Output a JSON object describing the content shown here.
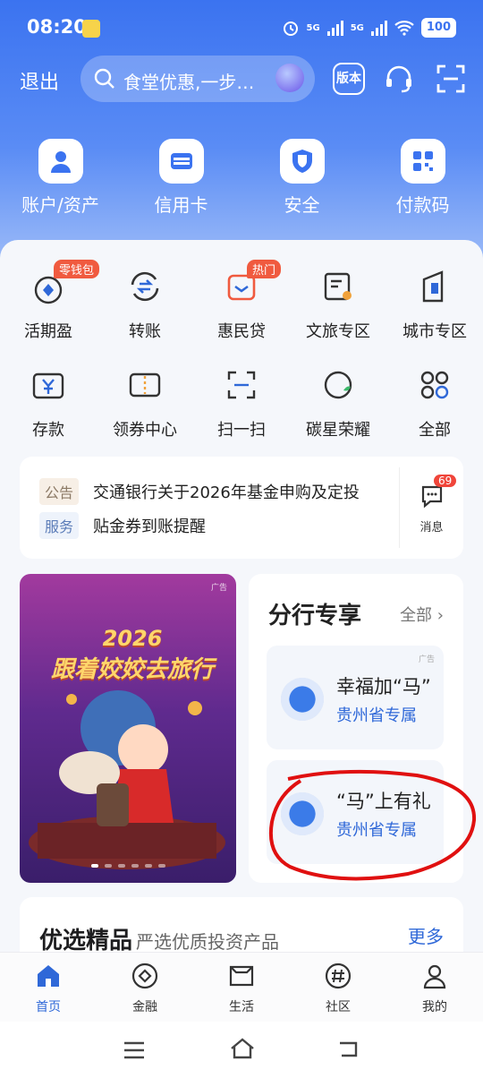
{
  "status_bar": {
    "time": "08:20",
    "network_1": "5G",
    "network_2": "5G",
    "battery": "100"
  },
  "top_bar": {
    "logout": "退出",
    "search_placeholder": "食堂优惠,一步…",
    "version_label": "版本"
  },
  "quick_actions": [
    {
      "label": "账户/资产",
      "icon": "person-icon"
    },
    {
      "label": "信用卡",
      "icon": "card-icon"
    },
    {
      "label": "安全",
      "icon": "shield-icon"
    },
    {
      "label": "付款码",
      "icon": "qr-code-icon"
    }
  ],
  "services_row1": [
    {
      "label": "活期盈",
      "badge": "零钱包",
      "icon": "piggy-icon"
    },
    {
      "label": "转账",
      "badge": "",
      "icon": "transfer-icon"
    },
    {
      "label": "惠民贷",
      "badge": "热门",
      "icon": "loan-icon"
    },
    {
      "label": "文旅专区",
      "badge": "",
      "icon": "scroll-icon"
    },
    {
      "label": "城市专区",
      "badge": "",
      "icon": "building-icon"
    }
  ],
  "services_row2": [
    {
      "label": "存款",
      "icon": "deposit-icon"
    },
    {
      "label": "领券中心",
      "icon": "coupon-icon"
    },
    {
      "label": "扫一扫",
      "icon": "scan-icon"
    },
    {
      "label": "碳星荣耀",
      "icon": "globe-icon"
    },
    {
      "label": "全部",
      "icon": "grid-icon"
    }
  ],
  "notices": [
    {
      "tag": "公告",
      "text": "交通银行关于2026年基金申购及定投"
    },
    {
      "tag": "服务",
      "text": "贴金券到账提醒"
    }
  ],
  "messages": {
    "label": "消息",
    "count": "69"
  },
  "banner": {
    "ad": "广告",
    "year": "2026",
    "title": "跟着姣姣去旅行"
  },
  "branch": {
    "title": "分行专享",
    "all_label": "全部",
    "cards": [
      {
        "title": "幸福加“马”",
        "subtitle": "贵州省专属",
        "ad": "广告"
      },
      {
        "title": "“马”上有礼",
        "subtitle": "贵州省专属",
        "ad": ""
      }
    ]
  },
  "selection": {
    "title": "优选精品",
    "subtitle": "严选优质投资产品",
    "more": "更多"
  },
  "tabs": [
    {
      "label": "首页",
      "active": true
    },
    {
      "label": "金融",
      "active": false
    },
    {
      "label": "生活",
      "active": false
    },
    {
      "label": "社区",
      "active": false
    },
    {
      "label": "我的",
      "active": false
    }
  ],
  "colors": {
    "primary": "#3b73f0",
    "accent_red": "#f05a3f",
    "link_blue": "#2f68d8",
    "annotation_red": "#e01010"
  }
}
